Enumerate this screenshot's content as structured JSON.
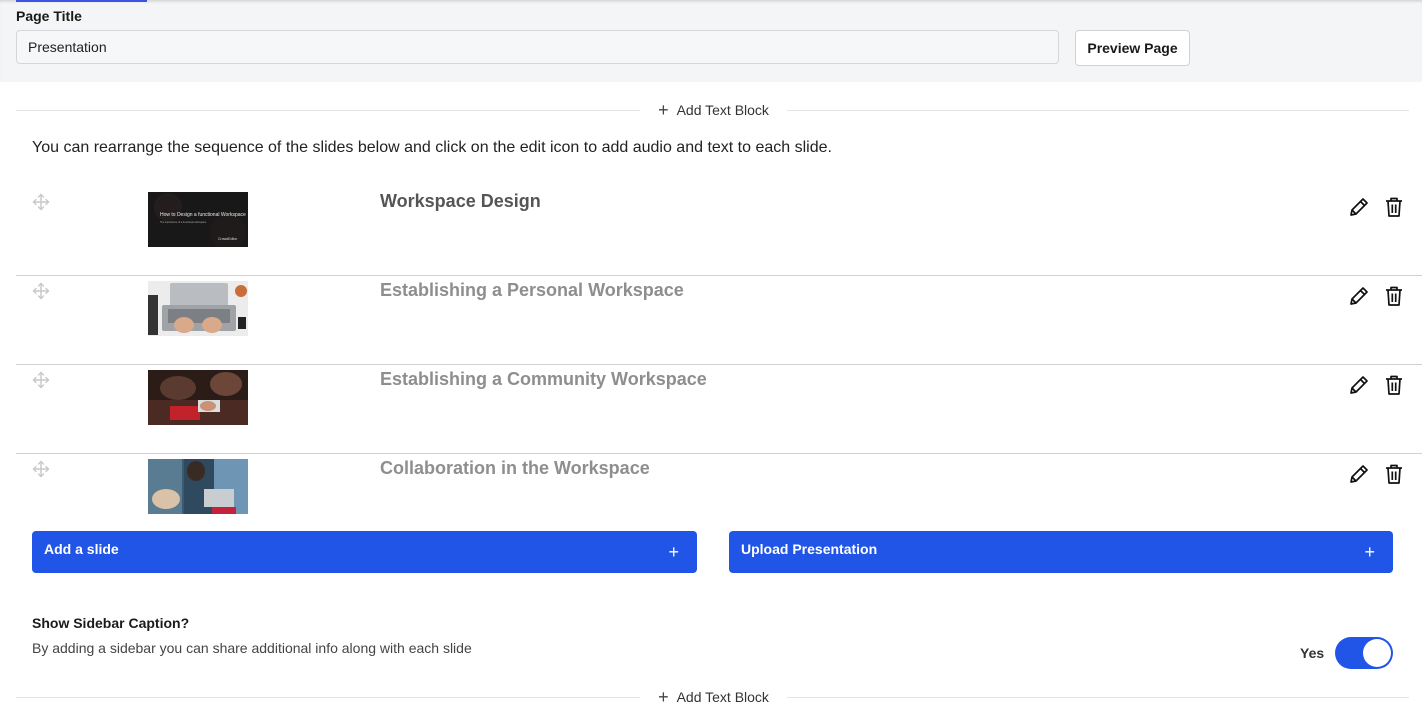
{
  "header": {
    "page_title_label": "Page Title",
    "page_title_value": "Presentation",
    "preview_button": "Preview Page"
  },
  "add_text_block_label": "Add Text Block",
  "instructions": "You can rearrange the sequence of the slides below and click on the edit icon to add audio and text to each slide.",
  "slides": [
    {
      "title": "Workspace Design",
      "thumb_text": "How to Design a functional Workspace",
      "thumb_sub": "The importance of a functional workspace",
      "thumb_brand": "CrowdEditor"
    },
    {
      "title": "Establishing a Personal Workspace"
    },
    {
      "title": "Establishing a Community Workspace"
    },
    {
      "title": "Collaboration in the Workspace"
    }
  ],
  "actions": {
    "add_slide": "Add a slide",
    "upload_presentation": "Upload Presentation",
    "plus": "+"
  },
  "sidebar_caption": {
    "heading": "Show Sidebar Caption?",
    "description": "By adding a sidebar you can share additional info along with each slide",
    "toggle_label": "Yes",
    "enabled": true
  },
  "colors": {
    "primary": "#2155e8",
    "tab_accent": "#3b54e6"
  },
  "icons": {
    "drag": "move-icon",
    "edit": "pencil-icon",
    "delete": "trash-icon",
    "add": "plus-icon"
  }
}
